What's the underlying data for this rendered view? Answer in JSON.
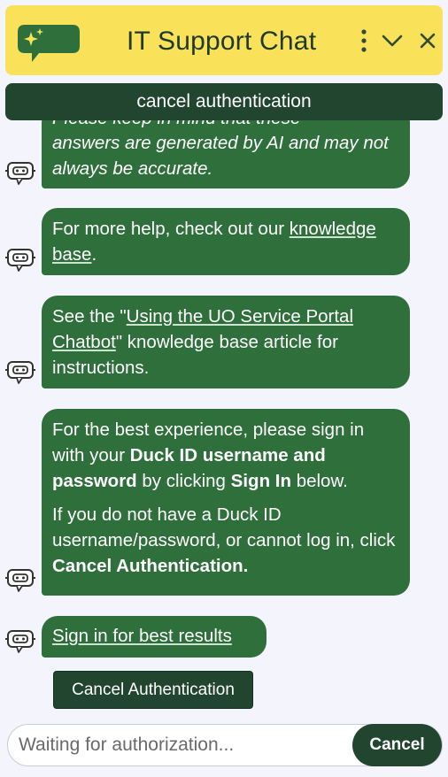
{
  "header": {
    "title": "IT Support Chat",
    "logo_icon": "chat-sparkle-icon",
    "menu_icon": "kebab-menu-icon",
    "minimize_icon": "chevron-down-icon",
    "close_icon": "close-icon"
  },
  "banner": {
    "label": "cancel authentication"
  },
  "messages": [
    {
      "partial_line": "Please keep in mind that these",
      "text": "answers are generated by AI and may not always be accurate."
    },
    {
      "prefix": "For more help, check out our ",
      "link": "knowledge base",
      "suffix": "."
    },
    {
      "prefix": "See the \"",
      "link": "Using the UO Service Portal Chatbot",
      "suffix": "\" knowledge base article for instructions."
    },
    {
      "p1_a": "For the best experience, please sign in with your ",
      "p1_b": "Duck ID username and password",
      "p1_c": " by clicking ",
      "p1_d": "Sign In",
      "p1_e": " below.",
      "p2_a": "If you do not have a Duck ID username/password, or cannot log in, click ",
      "p2_b": "Cancel Authentication."
    },
    {
      "link": "Sign in for best results"
    }
  ],
  "cancel_auth_button": {
    "label": "Cancel Authentication"
  },
  "composer": {
    "placeholder": "Waiting for authorization...",
    "cancel_label": "Cancel"
  },
  "colors": {
    "header_bg": "#f9e15a",
    "bubble_bg": "#2f6f3c",
    "dark_green": "#224530",
    "page_bg": "#f4f5fc"
  }
}
